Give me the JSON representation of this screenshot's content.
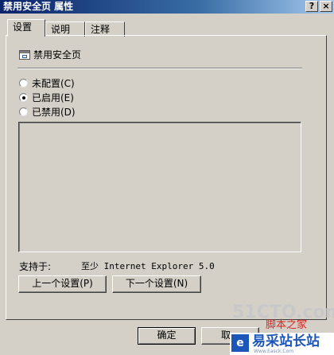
{
  "window": {
    "title": "禁用安全页 属性",
    "help_glyph": "?",
    "close_glyph": "×"
  },
  "tabs": [
    {
      "label": "设置",
      "active": true
    },
    {
      "label": "说明",
      "active": false
    },
    {
      "label": "注释",
      "active": false
    }
  ],
  "policy": {
    "icon": "policy-setting-icon",
    "name": "禁用安全页"
  },
  "options": [
    {
      "label": "未配置(C)",
      "checked": false
    },
    {
      "label": "已启用(E)",
      "checked": true
    },
    {
      "label": "已禁用(D)",
      "checked": false
    }
  ],
  "supported": {
    "label": "支持于:",
    "value": "至少 Internet Explorer 5.0"
  },
  "nav_buttons": {
    "prev": "上一个设置(P)",
    "next": "下一个设置(N)"
  },
  "dialog_buttons": {
    "ok": "确定",
    "cancel_partial": "取"
  },
  "watermarks": {
    "cto": "51CTO.com",
    "red_text": "脚本之家",
    "logo_mark": "e",
    "logo_text": "易采站长站",
    "logo_url": "Www.Easck.Com"
  },
  "colors": {
    "titlebar_start": "#0a246a",
    "titlebar_end": "#a6caf0",
    "face": "#d4d0c8",
    "logo_blue": "#1c57b8"
  }
}
